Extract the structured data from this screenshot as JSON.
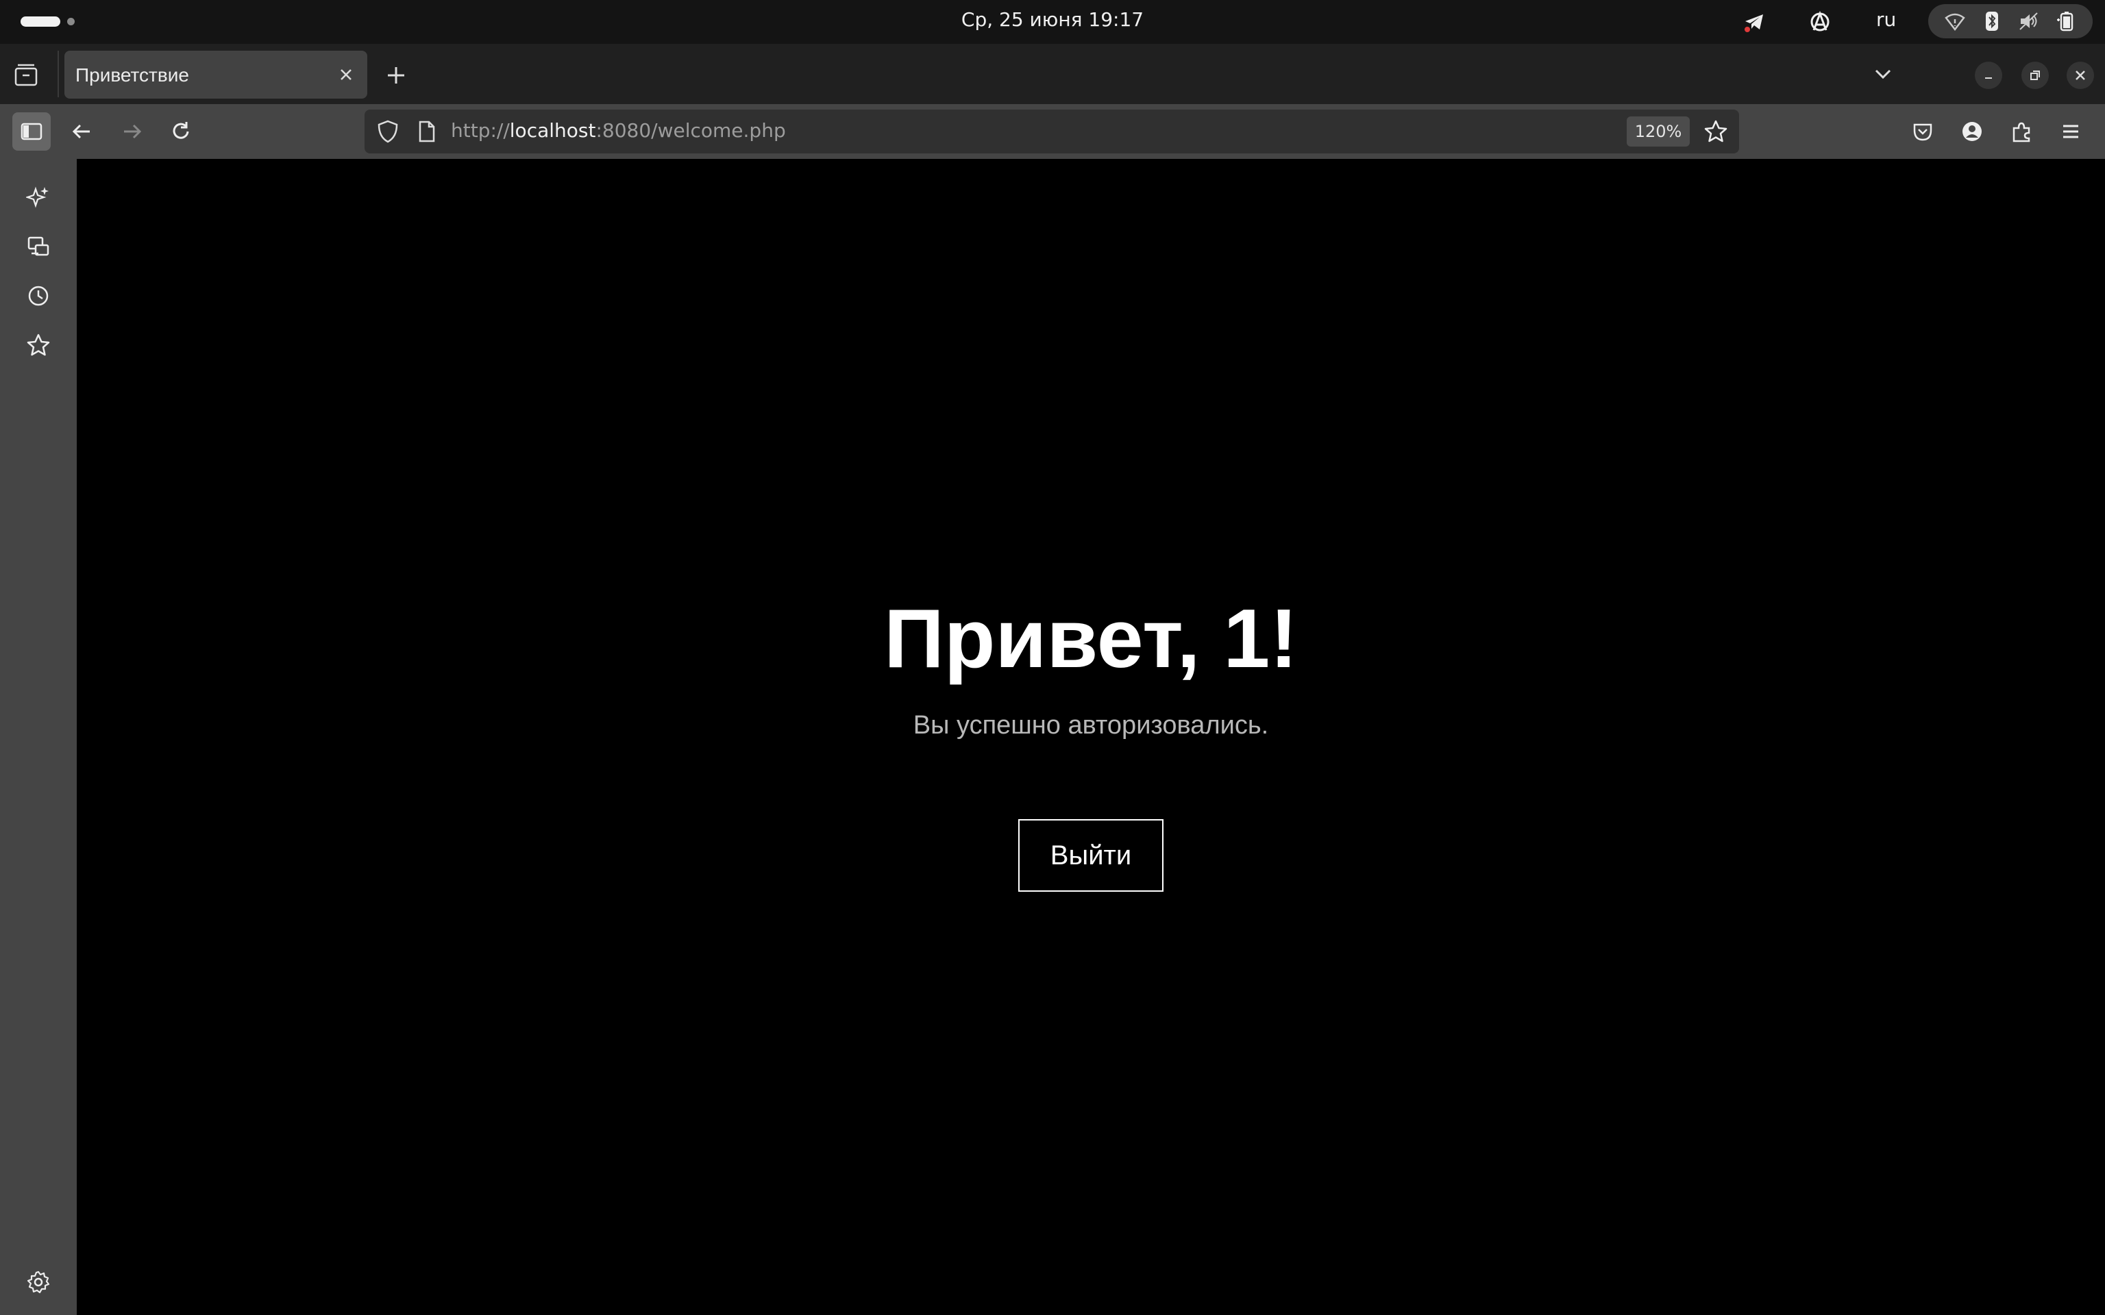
{
  "system_bar": {
    "datetime": "Ср, 25 июня  19:17",
    "language": "ru",
    "tray_icons": [
      "telegram-icon",
      "anarchy-icon"
    ],
    "quick_settings": [
      "wifi-icon",
      "bluetooth-icon",
      "volume-muted-icon",
      "battery-icon"
    ]
  },
  "browser": {
    "tabs": [
      {
        "title": "Приветствие",
        "active": true
      }
    ],
    "url": {
      "scheme": "http://",
      "host": "localhost",
      "rest": ":8080/welcome.php"
    },
    "zoom": "120%",
    "sidebar_items": [
      "ai-chatbot-icon",
      "synced-tabs-icon",
      "history-icon",
      "bookmarks-icon"
    ],
    "toolbar_right": [
      "pocket-icon",
      "account-icon",
      "extensions-icon",
      "menu-icon"
    ]
  },
  "page": {
    "greeting": "Привет, 1!",
    "subtitle": "Вы успешно авторизовались.",
    "logout_label": "Выйти"
  },
  "colors": {
    "page_background": "#000000",
    "toolbar_background": "#454545",
    "tabbar_background": "#202020",
    "text_primary": "#ffffff",
    "text_secondary": "#b8b8b8"
  }
}
